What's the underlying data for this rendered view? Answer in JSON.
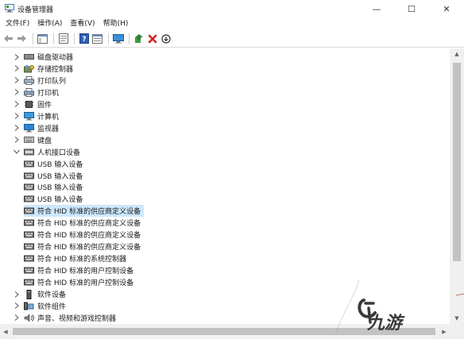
{
  "window": {
    "title": "设备管理器",
    "minimize": "—",
    "maximize": "☐",
    "close": "✕"
  },
  "menu": [
    "文件(F)",
    "操作(A)",
    "查看(V)",
    "帮助(H)"
  ],
  "toolbar": {
    "icons": [
      "back-icon",
      "forward-icon",
      "tree-view-icon",
      "properties-icon",
      "help-icon",
      "resource-view-icon",
      "monitor-icon",
      "update-driver-icon",
      "uninstall-icon",
      "scan-icon"
    ]
  },
  "tree": [
    {
      "label": "磁盘驱动器",
      "icon": "disk-drive-icon",
      "expander": "collapsed",
      "level": 0
    },
    {
      "label": "存储控制器",
      "icon": "storage-controller-icon",
      "expander": "collapsed",
      "level": 0
    },
    {
      "label": "打印队列",
      "icon": "printer-queue-icon",
      "expander": "collapsed",
      "level": 0
    },
    {
      "label": "打印机",
      "icon": "printer-icon",
      "expander": "collapsed",
      "level": 0
    },
    {
      "label": "固件",
      "icon": "firmware-icon",
      "expander": "collapsed",
      "level": 0
    },
    {
      "label": "计算机",
      "icon": "computer-icon",
      "expander": "collapsed",
      "level": 0
    },
    {
      "label": "监视器",
      "icon": "monitor-icon",
      "expander": "collapsed",
      "level": 0
    },
    {
      "label": "键盘",
      "icon": "keyboard-icon",
      "expander": "collapsed",
      "level": 0
    },
    {
      "label": "人机接口设备",
      "icon": "hid-icon",
      "expander": "expanded",
      "level": 0
    },
    {
      "label": "USB 输入设备",
      "icon": "hid-device-icon",
      "expander": "none",
      "level": 1
    },
    {
      "label": "USB 输入设备",
      "icon": "hid-device-icon",
      "expander": "none",
      "level": 1
    },
    {
      "label": "USB 输入设备",
      "icon": "hid-device-icon",
      "expander": "none",
      "level": 1
    },
    {
      "label": "USB 输入设备",
      "icon": "hid-device-icon",
      "expander": "none",
      "level": 1
    },
    {
      "label": "符合 HID 标准的供应商定义设备",
      "icon": "hid-device-icon",
      "expander": "none",
      "level": 1,
      "selected": true
    },
    {
      "label": "符合 HID 标准的供应商定义设备",
      "icon": "hid-device-icon",
      "expander": "none",
      "level": 1
    },
    {
      "label": "符合 HID 标准的供应商定义设备",
      "icon": "hid-device-icon",
      "expander": "none",
      "level": 1
    },
    {
      "label": "符合 HID 标准的供应商定义设备",
      "icon": "hid-device-icon",
      "expander": "none",
      "level": 1
    },
    {
      "label": "符合 HID 标准的系统控制器",
      "icon": "hid-device-icon",
      "expander": "none",
      "level": 1
    },
    {
      "label": "符合 HID 标准的用户控制设备",
      "icon": "hid-device-icon",
      "expander": "none",
      "level": 1
    },
    {
      "label": "符合 HID 标准的用户控制设备",
      "icon": "hid-device-icon",
      "expander": "none",
      "level": 1
    },
    {
      "label": "软件设备",
      "icon": "software-device-icon",
      "expander": "collapsed",
      "level": 0
    },
    {
      "label": "软件组件",
      "icon": "software-component-icon",
      "expander": "collapsed",
      "level": 0
    },
    {
      "label": "声音、视频和游戏控制器",
      "icon": "sound-icon",
      "expander": "collapsed",
      "level": 0
    }
  ],
  "watermark": {
    "text": "九游"
  },
  "colors": {
    "selection": "#cce8ff",
    "accent": "#0078d7"
  }
}
